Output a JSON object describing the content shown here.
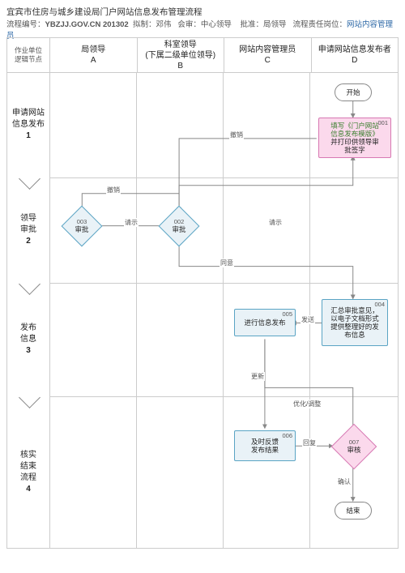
{
  "title": "宜宾市住房与城乡建设局门户网站信息发布管理流程",
  "meta": {
    "code_label": "流程编号：",
    "code": "YBZJJ.GOV.CN 201302",
    "author_label": "拟制：",
    "author": "邓伟",
    "review_label": "会审：",
    "review": "中心领导",
    "approve_label": "批准：",
    "approve": "局领导",
    "resp_label": "流程责任岗位：",
    "resp": "网站内容管理员"
  },
  "swim": {
    "corner": "作业单位\n逻辑节点",
    "lanes": [
      {
        "id": "A",
        "label": "局领导\nA"
      },
      {
        "id": "B",
        "label": "科室领导\n(下属二级单位领导)\nB"
      },
      {
        "id": "C",
        "label": "网站内容管理员\nC"
      },
      {
        "id": "D",
        "label": "申请网站信息发布者\nD"
      }
    ]
  },
  "rows": [
    {
      "id": "1",
      "label": "申请网站\n信息发布",
      "num": "1"
    },
    {
      "id": "2",
      "label": "领导\n审批",
      "num": "2"
    },
    {
      "id": "3",
      "label": "发布\n信息",
      "num": "3"
    },
    {
      "id": "4",
      "label": "核实\n结束\n流程",
      "num": "4"
    }
  ],
  "nodes": {
    "start": {
      "text": "开始"
    },
    "n001": {
      "tag": "001",
      "text": "填写《门户网站\n信息发布模版》\n并打印供领导审\n批签字",
      "key": "填写《门户网站\n信息发布模版》"
    },
    "n002": {
      "tag": "002",
      "text": "审批"
    },
    "n003": {
      "tag": "003",
      "text": "审批"
    },
    "n004": {
      "tag": "004",
      "text": "汇总审批意见，\n以电子文档形式\n提供整理好的发\n布信息"
    },
    "n005": {
      "tag": "005",
      "text": "进行信息发布"
    },
    "n006": {
      "tag": "006",
      "text": "及时反馈\n发布结果"
    },
    "n007": {
      "tag": "007",
      "text": "审核"
    },
    "end": {
      "text": "结束"
    }
  },
  "edges": {
    "disagree": "撤销",
    "ask": "请示",
    "agree": "同意",
    "send": "发送",
    "update": "更新",
    "feedback": "回复",
    "opt": "优化/调整",
    "confirm": "确认"
  }
}
